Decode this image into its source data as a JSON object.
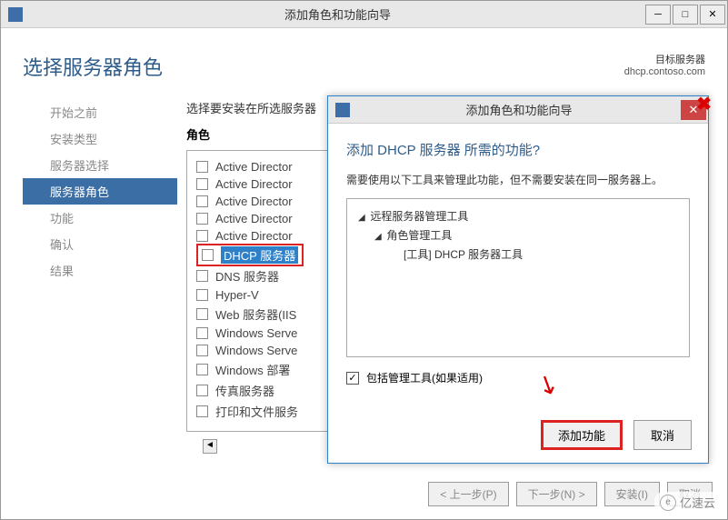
{
  "main_window": {
    "title": "添加角色和功能向导",
    "page_title": "选择服务器角色",
    "target_label": "目标服务器",
    "target_server": "dhcp.contoso.com",
    "instruction": "选择要安装在所选服务器",
    "roles_label": "角色"
  },
  "titlebar_controls": {
    "min": "─",
    "max": "□",
    "close": "✕"
  },
  "sidebar": {
    "items": [
      {
        "label": "开始之前"
      },
      {
        "label": "安装类型"
      },
      {
        "label": "服务器选择"
      },
      {
        "label": "服务器角色"
      },
      {
        "label": "功能"
      },
      {
        "label": "确认"
      },
      {
        "label": "结果"
      }
    ],
    "active_index": 3
  },
  "roles": [
    {
      "label": "Active Director"
    },
    {
      "label": "Active Director"
    },
    {
      "label": "Active Director"
    },
    {
      "label": "Active Director"
    },
    {
      "label": "Active Director"
    },
    {
      "label": "DHCP 服务器",
      "highlighted": true,
      "selected": true
    },
    {
      "label": "DNS 服务器"
    },
    {
      "label": "Hyper-V"
    },
    {
      "label": "Web 服务器(IIS"
    },
    {
      "label": "Windows Serve"
    },
    {
      "label": "Windows Serve"
    },
    {
      "label": "Windows 部署"
    },
    {
      "label": "传真服务器"
    },
    {
      "label": "打印和文件服务"
    }
  ],
  "footer": {
    "prev": "< 上一步(P)",
    "next": "下一步(N) >",
    "install": "安装(I)",
    "cancel": "取消"
  },
  "sub_dialog": {
    "title": "添加角色和功能向导",
    "heading": "添加 DHCP 服务器 所需的功能?",
    "description": "需要使用以下工具来管理此功能，但不需要安装在同一服务器上。",
    "tree": {
      "level0": "远程服务器管理工具",
      "level1": "角色管理工具",
      "level2": "[工具] DHCP 服务器工具"
    },
    "include_tools": "包括管理工具(如果适用)",
    "checked": "✓",
    "buttons": {
      "add": "添加功能",
      "cancel": "取消"
    },
    "close": "✕"
  },
  "scroll_left": "◄",
  "arrow": "➘",
  "watermark": {
    "icon": "e",
    "text": "亿速云"
  }
}
